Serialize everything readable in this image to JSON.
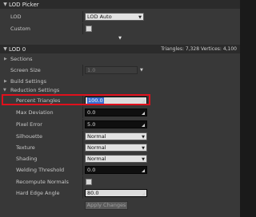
{
  "lod_picker": {
    "title": "LOD Picker",
    "lod_label": "LOD",
    "lod_value": "LOD Auto",
    "custom_label": "Custom",
    "collapse_glyph": "▼"
  },
  "lod0": {
    "title": "LOD 0",
    "stats": "Triangles: 7,328   Vertices: 4,100",
    "sections_label": "Sections",
    "screen_size_label": "Screen Size",
    "screen_size_value": "1.0",
    "build_settings_label": "Build Settings",
    "reduction_settings_label": "Reduction Settings",
    "fields": [
      {
        "label": "Percent Triangles",
        "value": "100.0"
      },
      {
        "label": "Max Deviation",
        "value": "0.0"
      },
      {
        "label": "Pixel Error",
        "value": "5.0"
      },
      {
        "label": "Silhouette",
        "value": "Normal"
      },
      {
        "label": "Texture",
        "value": "Normal"
      },
      {
        "label": "Shading",
        "value": "Normal"
      },
      {
        "label": "Welding Threshold",
        "value": "0.0"
      },
      {
        "label": "Recompute Normals",
        "value": ""
      },
      {
        "label": "Hard Edge Angle",
        "value": "80.0"
      }
    ],
    "apply_label": "Apply Changes"
  },
  "colors": {
    "highlight": "#e0101c",
    "panel_bg": "#383838",
    "header_bg": "#2b2b2b"
  }
}
